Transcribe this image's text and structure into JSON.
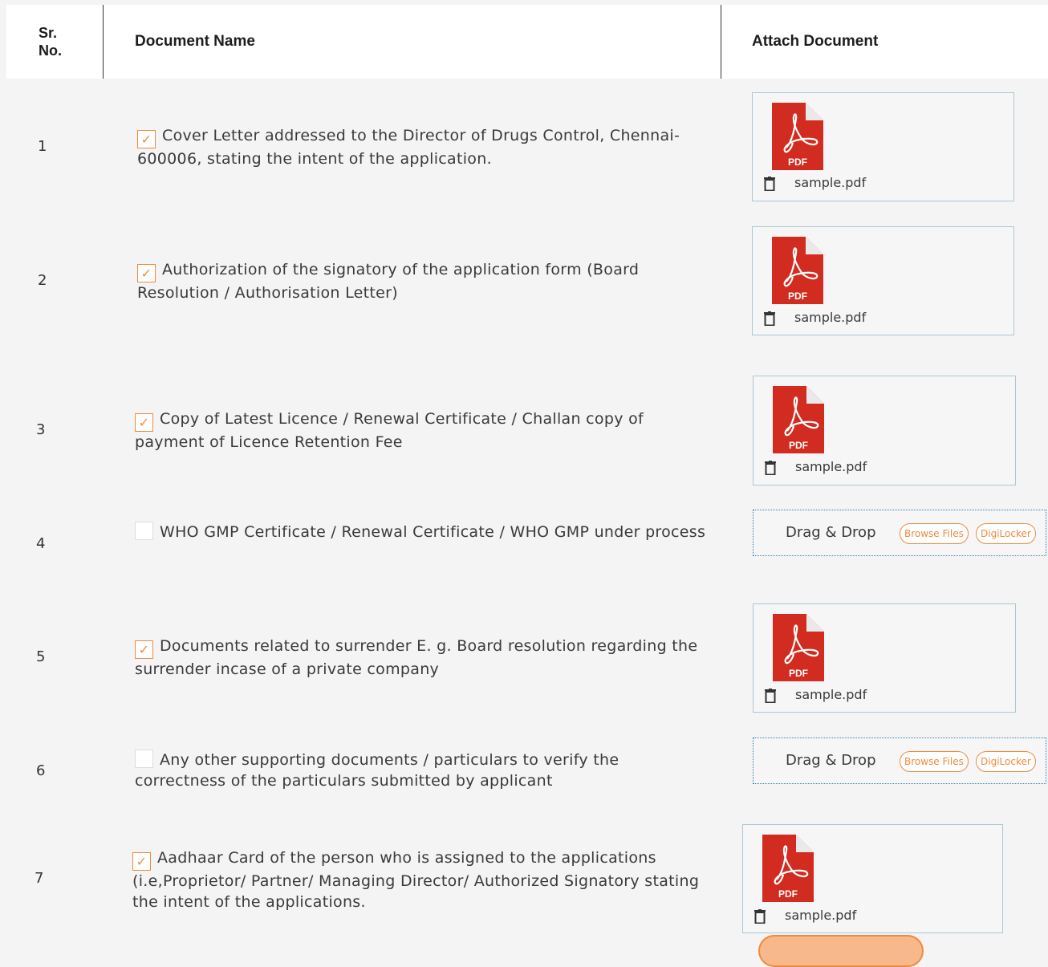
{
  "table": {
    "headers": {
      "sr_no": "Sr.\nNo.",
      "sr_line1": "Sr.",
      "sr_line2": "No.",
      "document_name": "Document Name",
      "attach_document": "Attach Document"
    },
    "rows": [
      {
        "sr": "1",
        "checked": true,
        "text": "Cover Letter addressed to the Director of Drugs Control, Chennai-600006, stating the intent of the application.",
        "attachment": {
          "type": "file",
          "file_name": "sample.pdf",
          "icon_label": "PDF"
        }
      },
      {
        "sr": "2",
        "checked": true,
        "text": "Authorization of the signatory of the application form (Board Resolution / Authorisation Letter)",
        "attachment": {
          "type": "file",
          "file_name": "sample.pdf",
          "icon_label": "PDF"
        }
      },
      {
        "sr": "3",
        "checked": true,
        "text": "Copy of Latest Licence / Renewal Certificate / Challan copy of payment of Licence Retention Fee",
        "attachment": {
          "type": "file",
          "file_name": "sample.pdf",
          "icon_label": "PDF"
        }
      },
      {
        "sr": "4",
        "checked": false,
        "text": "WHO GMP Certificate / Renewal Certificate / WHO GMP under process",
        "attachment": {
          "type": "upload",
          "drop_label": "Drag & Drop",
          "browse_label": "Browse Files",
          "digilocker_label": "DigiLocker"
        }
      },
      {
        "sr": "5",
        "checked": true,
        "text": "Documents related to surrender E. g. Board resolution regarding the surrender incase of a private company",
        "attachment": {
          "type": "file",
          "file_name": "sample.pdf",
          "icon_label": "PDF"
        }
      },
      {
        "sr": "6",
        "checked": false,
        "text": "Any other supporting documents / particulars to verify the correctness of the particulars submitted by applicant",
        "attachment": {
          "type": "upload",
          "drop_label": "Drag & Drop",
          "browse_label": "Browse Files",
          "digilocker_label": "DigiLocker"
        }
      },
      {
        "sr": "7",
        "checked": true,
        "text": "Aadhaar Card of the person who is assigned to the applications (i.e,Proprietor/ Partner/ Managing Director/ Authorized Signatory stating the intent of the applications.",
        "attachment": {
          "type": "file",
          "file_name": "sample.pdf",
          "icon_label": "PDF"
        }
      }
    ]
  },
  "colors": {
    "accent": "#f08a3c",
    "pdf_red": "#d22b20",
    "border_blue": "#a9c8d3",
    "dropzone_border": "#2f7fb1"
  },
  "icons": {
    "check": "checkmark-icon",
    "file": "pdf-file-icon",
    "delete": "trash-icon"
  },
  "check_glyph": "✓"
}
